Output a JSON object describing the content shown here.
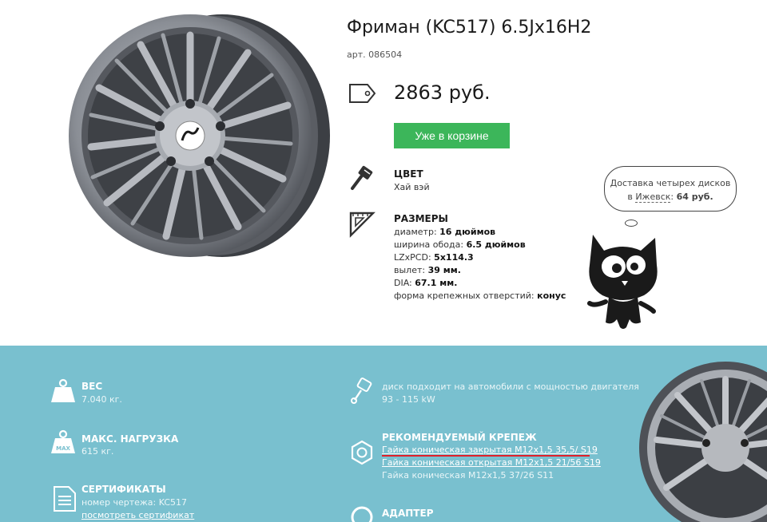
{
  "product": {
    "title": "Фриман (KC517) 6.5Jx16H2",
    "sku": "арт. 086504",
    "price": "2863 руб.",
    "cart_button": "Уже в корзине"
  },
  "color": {
    "heading": "ЦВЕТ",
    "value": "Хай вэй"
  },
  "sizes": {
    "heading": "РАЗМЕРЫ",
    "diameter_label": "диаметр: ",
    "diameter_value": "16 дюймов",
    "width_label": "ширина обода: ",
    "width_value": "6.5 дюймов",
    "pcd_label": "LZxPCD: ",
    "pcd_value": "5x114.3",
    "offset_label": "вылет: ",
    "offset_value": "39 мм.",
    "dia_label": "DIA: ",
    "dia_value": "67.1 мм.",
    "holes_label": "форма крепежных отверстий: ",
    "holes_value": "конус"
  },
  "delivery": {
    "line1": "Доставка четырех дисков",
    "line2_prefix": "в ",
    "city": "Ижевск",
    "line2_mid": ": ",
    "price": "64 руб."
  },
  "weight": {
    "heading": "ВЕС",
    "value": "7.040 кг."
  },
  "max_load": {
    "heading": "МАКС. НАГРУЗКА",
    "value": "615 кг.",
    "icon_label": "MAX"
  },
  "certificates": {
    "heading": "СЕРТИФИКАТЫ",
    "drawing": "номер чертежа: KC517",
    "link": "посмотреть сертификат"
  },
  "power": {
    "line1": "диск подходит на автомобили с мощностью двигателя",
    "line2": "93 - 115 kW"
  },
  "fasteners": {
    "heading": "РЕКОМЕНДУЕМЫЙ КРЕПЕЖ",
    "items": [
      "Гайка коническая закрытая M12x1,5 35,5/ S19",
      "Гайка коническая открытая M12x1,5 21/56 S19",
      "Гайка коническая M12x1,5 37/26 S11"
    ]
  },
  "adapter": {
    "heading": "АДАПТЕР"
  },
  "colors": {
    "accent_green": "#3cb65a",
    "panel_blue": "#79c0cf",
    "highlight_red": "#e0202a"
  }
}
